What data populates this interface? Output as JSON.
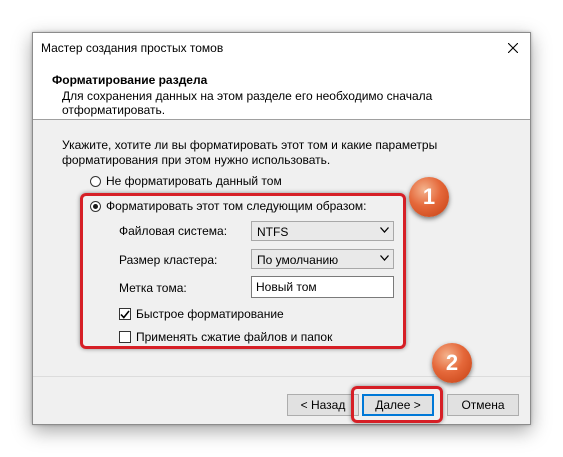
{
  "window": {
    "title": "Мастер создания простых томов"
  },
  "header": {
    "title": "Форматирование раздела",
    "subtitle": "Для сохранения данных на этом разделе его необходимо сначала отформатировать."
  },
  "intro": "Укажите, хотите ли вы форматировать этот том и какие параметры форматирования при этом нужно использовать.",
  "options": {
    "no_format": {
      "label": "Не форматировать данный том",
      "checked": false
    },
    "format": {
      "label": "Форматировать этот том следующим образом:",
      "checked": true
    }
  },
  "fields": {
    "filesystem": {
      "label": "Файловая система:",
      "value": "NTFS"
    },
    "cluster": {
      "label": "Размер кластера:",
      "value": "По умолчанию"
    },
    "volume_label": {
      "label": "Метка тома:",
      "value": "Новый том"
    }
  },
  "checkboxes": {
    "quick_format": {
      "label": "Быстрое форматирование",
      "checked": true
    },
    "compression": {
      "label": "Применять сжатие файлов и папок",
      "checked": false
    }
  },
  "buttons": {
    "back": "< Назад",
    "next": "Далее >",
    "cancel": "Отмена"
  },
  "annotations": {
    "badge1": "1",
    "badge2": "2"
  },
  "colors": {
    "highlight": "#d61f26",
    "badge": "#e5683a",
    "accent": "#0078d7"
  },
  "icons": {
    "close": "close-icon",
    "dropdown": "chevron-down-icon",
    "check": "check-icon"
  }
}
